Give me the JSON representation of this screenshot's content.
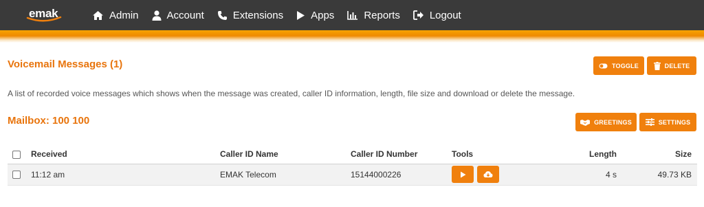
{
  "app": {
    "logo_text": "emak"
  },
  "nav": {
    "items": [
      {
        "label": "Admin",
        "icon": "home-icon"
      },
      {
        "label": "Account",
        "icon": "user-icon"
      },
      {
        "label": "Extensions",
        "icon": "phone-icon"
      },
      {
        "label": "Apps",
        "icon": "play-icon"
      },
      {
        "label": "Reports",
        "icon": "chart-icon"
      },
      {
        "label": "Logout",
        "icon": "logout-icon"
      }
    ]
  },
  "page": {
    "title": "Voicemail Messages (1)",
    "description": "A list of recorded voice messages which shows when the message was created, caller ID information, length, file size and download or delete the message.",
    "mailbox": "Mailbox: 100 100"
  },
  "actions": {
    "toggle": "TOGGLE",
    "delete": "DELETE",
    "greetings": "GREETINGS",
    "settings": "SETTINGS"
  },
  "table": {
    "headers": {
      "received": "Received",
      "caller_id_name": "Caller ID Name",
      "caller_id_number": "Caller ID Number",
      "tools": "Tools",
      "length": "Length",
      "size": "Size"
    },
    "rows": [
      {
        "received": "11:12 am",
        "caller_id_name": "EMAK Telecom",
        "caller_id_number": "15144000226",
        "length": "4 s",
        "size": "49.73 KB"
      }
    ]
  },
  "colors": {
    "accent": "#f0800d",
    "title": "#e8740c",
    "topbar": "#3a3a3a"
  }
}
